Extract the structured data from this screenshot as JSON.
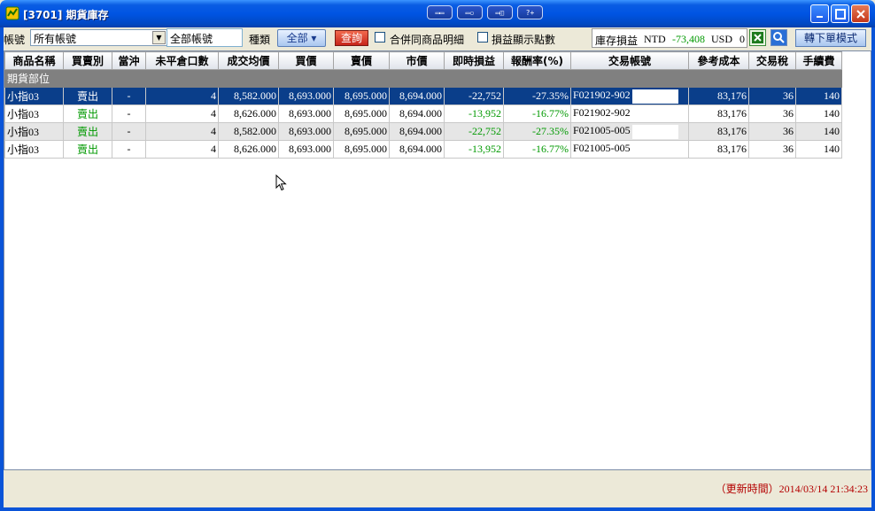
{
  "window": {
    "title": "[3701] 期貨庫存",
    "toolbar_icons": [
      "layout-icon",
      "window-icon",
      "snapshot-icon",
      "help-icon"
    ],
    "tool_labels": [
      "▭▭",
      "▭▫",
      "▭◫",
      "?+"
    ]
  },
  "filters": {
    "account_label": "帳號",
    "account_value": "所有帳號",
    "account_text": "全部帳號",
    "type_label": "種類",
    "type_value": "全部",
    "query_button": "查詢",
    "merge_label": "合併同商品明細",
    "points_label": "損益顯示點數"
  },
  "pl_summary": {
    "label": "庫存損益",
    "ntd_label": "NTD",
    "ntd_value": "-73,408",
    "usd_label": "USD",
    "usd_value": "0"
  },
  "actions": {
    "order_mode_button": "轉下單模式"
  },
  "table": {
    "columns": [
      "商品名稱",
      "買賣別",
      "當沖",
      "未平倉口數",
      "成交均價",
      "買價",
      "賣價",
      "市價",
      "即時損益",
      "報酬率(%)",
      "交易帳號",
      "參考成本",
      "交易稅",
      "手續費"
    ],
    "group_label": "期貨部位",
    "rows": [
      {
        "product": "小指03",
        "side": "賣出",
        "daytrade": "-",
        "open_qty": "4",
        "avg_price": "8,582.000",
        "bid": "8,693.000",
        "ask": "8,695.000",
        "market": "8,694.000",
        "pnl": "-22,752",
        "return": "-27.35%",
        "account": "F021902-902",
        "ref_cost": "83,176",
        "tax": "36",
        "fee": "140"
      },
      {
        "product": "小指03",
        "side": "賣出",
        "daytrade": "-",
        "open_qty": "4",
        "avg_price": "8,626.000",
        "bid": "8,693.000",
        "ask": "8,695.000",
        "market": "8,694.000",
        "pnl": "-13,952",
        "return": "-16.77%",
        "account": "F021902-902",
        "ref_cost": "83,176",
        "tax": "36",
        "fee": "140"
      },
      {
        "product": "小指03",
        "side": "賣出",
        "daytrade": "-",
        "open_qty": "4",
        "avg_price": "8,582.000",
        "bid": "8,693.000",
        "ask": "8,695.000",
        "market": "8,694.000",
        "pnl": "-22,752",
        "return": "-27.35%",
        "account": "F021005-005",
        "ref_cost": "83,176",
        "tax": "36",
        "fee": "140"
      },
      {
        "product": "小指03",
        "side": "賣出",
        "daytrade": "-",
        "open_qty": "4",
        "avg_price": "8,626.000",
        "bid": "8,693.000",
        "ask": "8,695.000",
        "market": "8,694.000",
        "pnl": "-13,952",
        "return": "-16.77%",
        "account": "F021005-005",
        "ref_cost": "83,176",
        "tax": "36",
        "fee": "140"
      }
    ]
  },
  "status": {
    "update_time": "（更新時間）2014/03/14 21:34:23"
  },
  "colors": {
    "title_bar": "#0054e3",
    "selected_row": "#0a3e8a",
    "group_row": "#808080",
    "positive_green": "#009900",
    "status_red": "#b40000"
  }
}
